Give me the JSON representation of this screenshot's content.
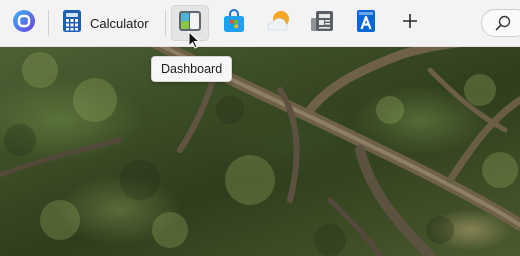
{
  "taskbar": {
    "items": [
      {
        "icon": "cortana-icon"
      },
      {
        "icon": "calculator-icon",
        "label": "Calculator"
      },
      {
        "icon": "widgets-dashboard-icon",
        "state": "hover"
      },
      {
        "icon": "microsoft-store-icon"
      },
      {
        "icon": "weather-icon"
      },
      {
        "icon": "news-icon"
      },
      {
        "icon": "dictionary-app-icon"
      },
      {
        "icon": "add-icon"
      }
    ],
    "search_icon": "search-icon"
  },
  "tooltip": {
    "text": "Dashboard"
  },
  "colors": {
    "taskbar_bg": "#f3f3f3",
    "accent_blue": "#0a66d6",
    "store_blue": "#1ea1f2"
  },
  "wallpaper": "forest tree branches"
}
